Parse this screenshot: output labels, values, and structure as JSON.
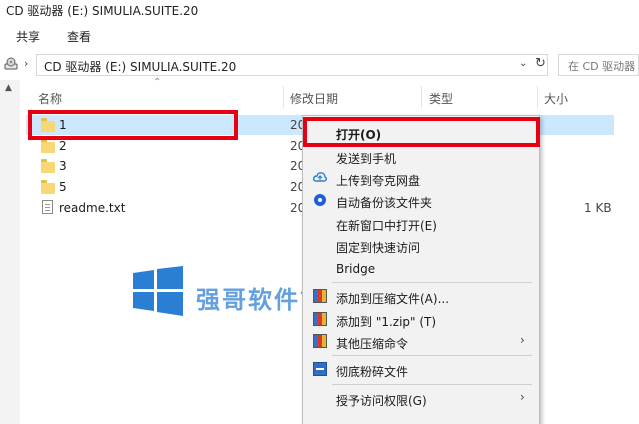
{
  "window": {
    "title": "CD 驱动器 (E:) SIMULIA.SUITE.20"
  },
  "ribbon": {
    "tabs": [
      "共享",
      "查看"
    ]
  },
  "address": {
    "path": "CD 驱动器 (E:) SIMULIA.SUITE.20",
    "chevron": "›",
    "search_placeholder": "在 CD 驱动器"
  },
  "columns": {
    "name": "名称",
    "date": "修改日期",
    "type": "类型",
    "size": "大小"
  },
  "files": [
    {
      "name": "1",
      "kind": "folder",
      "date": "20",
      "size": ""
    },
    {
      "name": "2",
      "kind": "folder",
      "date": "20",
      "size": ""
    },
    {
      "name": "3",
      "kind": "folder",
      "date": "20",
      "size": ""
    },
    {
      "name": "5",
      "kind": "folder",
      "date": "20",
      "size": ""
    },
    {
      "name": "readme.txt",
      "kind": "file",
      "date": "20",
      "size": "1 KB"
    }
  ],
  "context_menu": {
    "items": [
      "打开(O)",
      "发送到手机",
      "上传到夸克网盘",
      "自动备份该文件夹",
      "在新窗口中打开(E)",
      "固定到快速访问",
      "Bridge",
      "添加到压缩文件(A)...",
      "添加到 \"1.zip\" (T)",
      "其他压缩命令",
      "彻底粉碎文件",
      "授予访问权限(G)"
    ],
    "submenu_arrow": "›"
  },
  "watermark": {
    "text": "强哥软件管家"
  },
  "colors": {
    "selection": "#cce8ff",
    "highlight_border": "#e60012",
    "watermark": "#4a90d9",
    "folder": "#f8d775"
  }
}
